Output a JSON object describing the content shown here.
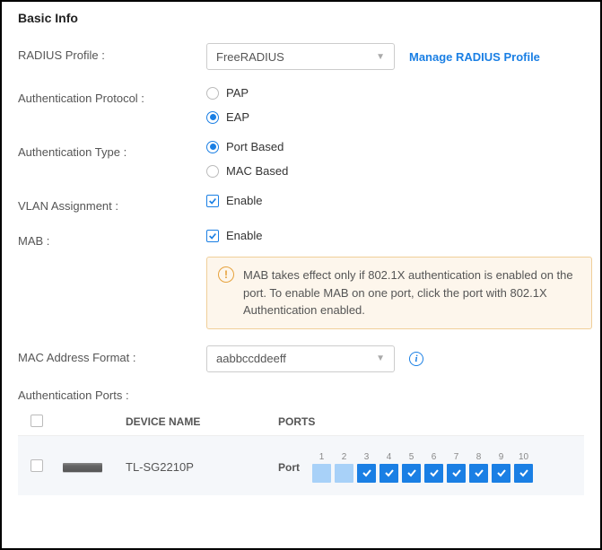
{
  "section_title": "Basic Info",
  "radius": {
    "label": "RADIUS Profile :",
    "value": "FreeRADIUS",
    "manage_link": "Manage RADIUS Profile"
  },
  "auth_protocol": {
    "label": "Authentication Protocol :",
    "options": [
      {
        "label": "PAP",
        "checked": false
      },
      {
        "label": "EAP",
        "checked": true
      }
    ]
  },
  "auth_type": {
    "label": "Authentication Type :",
    "options": [
      {
        "label": "Port Based",
        "checked": true
      },
      {
        "label": "MAC Based",
        "checked": false
      }
    ]
  },
  "vlan": {
    "label": "VLAN Assignment :",
    "option": "Enable",
    "checked": true
  },
  "mab": {
    "label": "MAB :",
    "option": "Enable",
    "checked": true
  },
  "note": "MAB takes effect only if 802.1X authentication is enabled on the port. To enable MAB on one port, click the port with 802.1X Authentication enabled.",
  "mac_format": {
    "label": "MAC Address Format :",
    "value": "aabbccddeeff"
  },
  "auth_ports_label": "Authentication Ports :",
  "table": {
    "headers": {
      "device_name": "DEVICE NAME",
      "ports": "PORTS"
    },
    "rows": [
      {
        "name": "TL-SG2210P",
        "port_label": "Port",
        "ports": [
          {
            "n": "1",
            "state": "light"
          },
          {
            "n": "2",
            "state": "light"
          },
          {
            "n": "3",
            "state": "on"
          },
          {
            "n": "4",
            "state": "on"
          },
          {
            "n": "5",
            "state": "on"
          },
          {
            "n": "6",
            "state": "on"
          },
          {
            "n": "7",
            "state": "on-outlined"
          },
          {
            "n": "8",
            "state": "on-outlined"
          },
          {
            "n": "9",
            "state": "on-outlined"
          },
          {
            "n": "10",
            "state": "on-outlined"
          }
        ]
      }
    ]
  }
}
